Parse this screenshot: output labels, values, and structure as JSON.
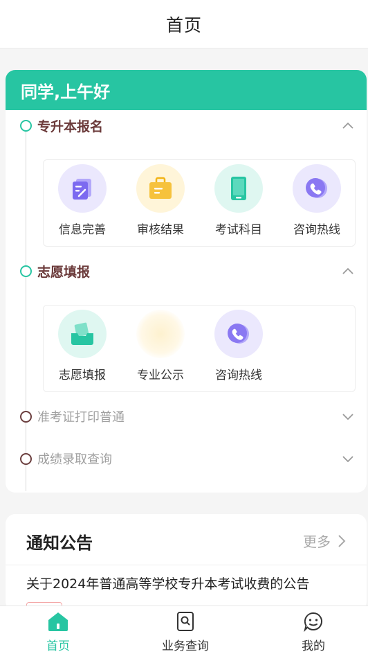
{
  "header": {
    "title": "首页"
  },
  "greeting": "同学,上午好",
  "sections": [
    {
      "label": "专升本报名",
      "state": "expanded",
      "items": [
        {
          "label": "信息完善",
          "icon": "edit-document-icon",
          "bg": "#ebe8fd",
          "color": "#7c6af0"
        },
        {
          "label": "审核结果",
          "icon": "briefcase-icon",
          "bg": "#fff5d9",
          "color": "#f6c23d"
        },
        {
          "label": "考试科目",
          "icon": "tablet-icon",
          "bg": "#dff7f1",
          "color": "#27c5a2"
        },
        {
          "label": "咨询热线",
          "icon": "phone-icon",
          "bg": "#ebe8fd",
          "color": "#7c6af0"
        }
      ]
    },
    {
      "label": "志愿填报",
      "state": "expanded",
      "items": [
        {
          "label": "志愿填报",
          "icon": "inbox-edit-icon",
          "bg": "#dff7f1",
          "color": "#27c5a2"
        },
        {
          "label": "专业公示",
          "icon": "blurred-icon",
          "bg": "#fff8e6",
          "color": "#f6e3a7"
        },
        {
          "label": "咨询热线",
          "icon": "phone-icon",
          "bg": "#ebe8fd",
          "color": "#7c6af0"
        }
      ]
    },
    {
      "label": "准考证打印普通",
      "state": "collapsed",
      "items": []
    },
    {
      "label": "成绩录取查询",
      "state": "collapsed",
      "items": []
    }
  ],
  "notice": {
    "title": "通知公告",
    "more": "更多",
    "items": [
      {
        "title": "关于2024年普通高等学校专升本考试收费的公告"
      }
    ]
  },
  "tabs": [
    {
      "label": "首页",
      "icon": "home-icon",
      "active": true
    },
    {
      "label": "业务查询",
      "icon": "search-document-icon",
      "active": false
    },
    {
      "label": "我的",
      "icon": "smiley-chat-icon",
      "active": false
    }
  ],
  "colors": {
    "accent": "#27c5a2",
    "section_title": "#6b3a3a",
    "muted": "#a0a0a0"
  }
}
